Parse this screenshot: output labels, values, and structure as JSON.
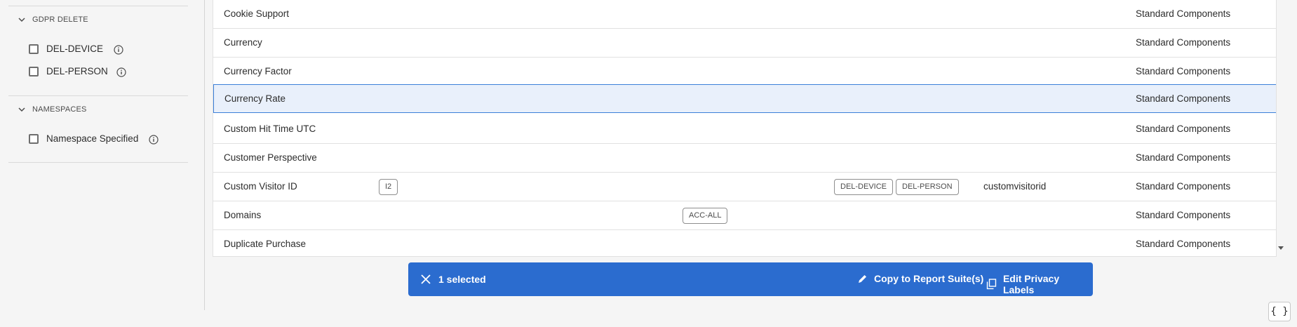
{
  "sidebar": {
    "gdpr_delete": {
      "title": "GDPR DELETE",
      "items": [
        {
          "label": "DEL-DEVICE"
        },
        {
          "label": "DEL-PERSON"
        }
      ]
    },
    "namespaces": {
      "title": "NAMESPACES",
      "items": [
        {
          "label": "Namespace Specified"
        }
      ]
    }
  },
  "table": {
    "rows": [
      {
        "name": "Cookie Support",
        "group": "Standard Components"
      },
      {
        "name": "Currency",
        "group": "Standard Components"
      },
      {
        "name": "Currency Factor",
        "group": "Standard Components"
      },
      {
        "name": "Currency Rate",
        "group": "Standard Components",
        "selected": true
      },
      {
        "name": "Custom Hit Time UTC",
        "group": "Standard Components"
      },
      {
        "name": "Customer Perspective",
        "group": "Standard Components"
      },
      {
        "name": "Custom Visitor ID",
        "group": "Standard Components",
        "identity_label": "I2",
        "delete_labels": [
          "DEL-DEVICE",
          "DEL-PERSON"
        ],
        "variable": "customvisitorid"
      },
      {
        "name": "Domains",
        "group": "Standard Components",
        "governance_label": "ACC-ALL"
      },
      {
        "name": "Duplicate Purchase",
        "group": "Standard Components"
      }
    ]
  },
  "action_bar": {
    "selected_text": "1 selected",
    "copy_label": "Copy to Report Suite(s)",
    "edit_label": "Edit Privacy Labels"
  },
  "code_button": {
    "label": "{ }"
  },
  "colors": {
    "accent": "#2b6ccf",
    "selected_row_bg": "#e9f0fb",
    "selected_row_border": "#3b7fd9"
  }
}
